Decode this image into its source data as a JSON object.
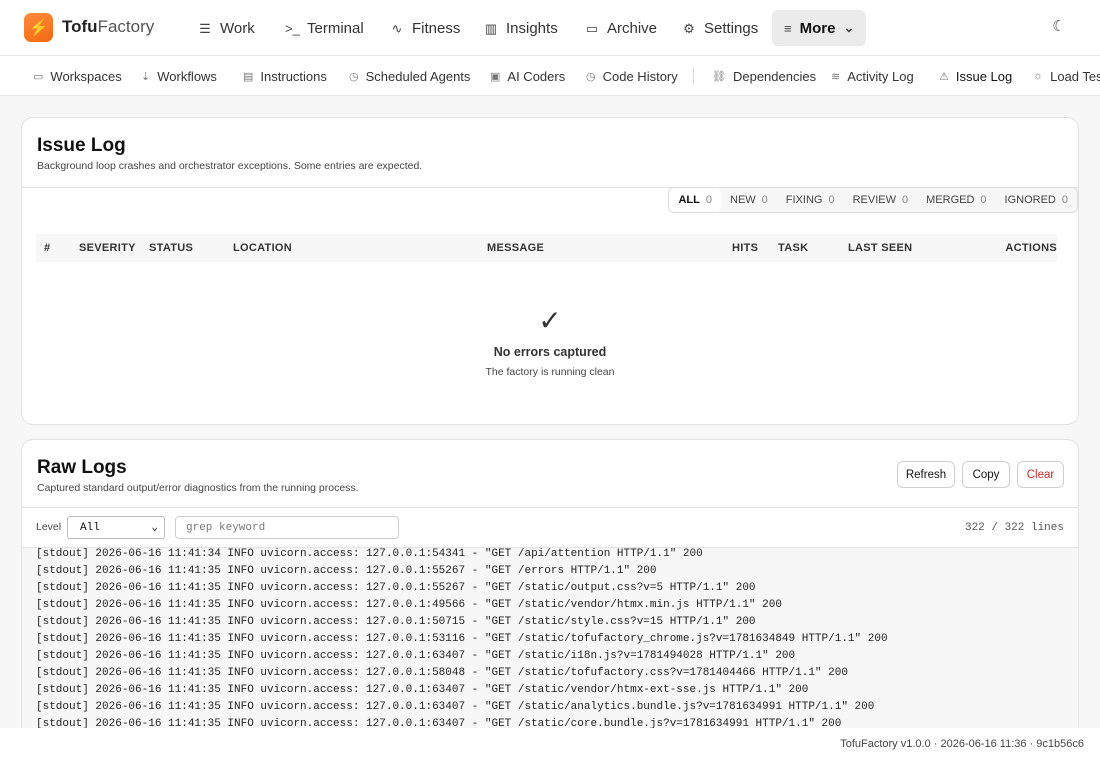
{
  "brand": {
    "name_bold": "Tofu",
    "name_rest": "Factory",
    "logo_glyph": "⚡",
    "accent": "#f36a12"
  },
  "topnav": [
    {
      "label": "Work",
      "icon": "list-icon",
      "glyph": "☰"
    },
    {
      "label": "Terminal",
      "icon": "terminal-icon",
      "glyph": ">_"
    },
    {
      "label": "Fitness",
      "icon": "pulse-icon",
      "glyph": "∿"
    },
    {
      "label": "Insights",
      "icon": "bar-chart-icon",
      "glyph": "▥"
    },
    {
      "label": "Archive",
      "icon": "archive-icon",
      "glyph": "▭"
    },
    {
      "label": "Settings",
      "icon": "gear-icon",
      "glyph": "⚙"
    },
    {
      "label": "More",
      "icon": "menu-icon",
      "glyph": "≡",
      "chevron": "⌄"
    }
  ],
  "theme_toggle_glyph": "☾",
  "subnav": [
    {
      "label": "Workspaces",
      "icon": "folder-icon",
      "glyph": "▭"
    },
    {
      "label": "Workflows",
      "icon": "workflow-icon",
      "glyph": "⇣"
    },
    {
      "label": "Instructions",
      "icon": "document-icon",
      "glyph": "▤"
    },
    {
      "label": "Scheduled Agents",
      "icon": "clock-icon",
      "glyph": "◷"
    },
    {
      "label": "AI Coders",
      "icon": "chip-icon",
      "glyph": "▣"
    },
    {
      "label": "Code History",
      "icon": "history-icon",
      "glyph": "◷"
    },
    {
      "label": "Dependencies",
      "icon": "link-icon",
      "glyph": "⛓"
    },
    {
      "label": "Activity Log",
      "icon": "wifi-icon",
      "glyph": "≋"
    },
    {
      "label": "Issue Log",
      "icon": "warning-icon",
      "glyph": "⚠",
      "active": true
    },
    {
      "label": "Load Test",
      "icon": "sun-icon",
      "glyph": "☼"
    }
  ],
  "issue_log": {
    "title": "Issue Log",
    "subtitle": "Background loop crashes and orchestrator exceptions. Some entries are expected.",
    "filters": [
      {
        "label": "ALL",
        "count": "0",
        "active": true
      },
      {
        "label": "NEW",
        "count": "0"
      },
      {
        "label": "FIXING",
        "count": "0"
      },
      {
        "label": "REVIEW",
        "count": "0"
      },
      {
        "label": "MERGED",
        "count": "0"
      },
      {
        "label": "IGNORED",
        "count": "0"
      }
    ],
    "columns": [
      "#",
      "SEVERITY",
      "STATUS",
      "LOCATION",
      "MESSAGE",
      "HITS",
      "TASK",
      "LAST SEEN",
      "ACTIONS"
    ],
    "empty_glyph": "✓",
    "empty_title": "No errors captured",
    "empty_subtitle": "The factory is running clean"
  },
  "raw_logs": {
    "title": "Raw Logs",
    "subtitle": "Captured standard output/error diagnostics from the running process.",
    "buttons": {
      "refresh": "Refresh",
      "copy": "Copy",
      "clear": "Clear"
    },
    "danger_color": "#c62828",
    "level_label": "Level",
    "level_value": "All",
    "grep_placeholder": "grep keyword",
    "line_count": "322 / 322 lines",
    "lines": [
      "[stdout] 2026-06-16 11:41:34 INFO uvicorn.access: 127.0.0.1:54341 - \"GET /api/attention HTTP/1.1\" 200",
      "[stdout] 2026-06-16 11:41:35 INFO uvicorn.access: 127.0.0.1:55267 - \"GET /errors HTTP/1.1\" 200",
      "[stdout] 2026-06-16 11:41:35 INFO uvicorn.access: 127.0.0.1:55267 - \"GET /static/output.css?v=5 HTTP/1.1\" 200",
      "[stdout] 2026-06-16 11:41:35 INFO uvicorn.access: 127.0.0.1:49566 - \"GET /static/vendor/htmx.min.js HTTP/1.1\" 200",
      "[stdout] 2026-06-16 11:41:35 INFO uvicorn.access: 127.0.0.1:50715 - \"GET /static/style.css?v=15 HTTP/1.1\" 200",
      "[stdout] 2026-06-16 11:41:35 INFO uvicorn.access: 127.0.0.1:53116 - \"GET /static/tofufactory_chrome.js?v=1781634849 HTTP/1.1\" 200",
      "[stdout] 2026-06-16 11:41:35 INFO uvicorn.access: 127.0.0.1:63407 - \"GET /static/i18n.js?v=1781494028 HTTP/1.1\" 200",
      "[stdout] 2026-06-16 11:41:35 INFO uvicorn.access: 127.0.0.1:58048 - \"GET /static/tofufactory.css?v=1781404466 HTTP/1.1\" 200",
      "[stdout] 2026-06-16 11:41:35 INFO uvicorn.access: 127.0.0.1:63407 - \"GET /static/vendor/htmx-ext-sse.js HTTP/1.1\" 200",
      "[stdout] 2026-06-16 11:41:35 INFO uvicorn.access: 127.0.0.1:63407 - \"GET /static/analytics.bundle.js?v=1781634991 HTTP/1.1\" 200",
      "[stdout] 2026-06-16 11:41:35 INFO uvicorn.access: 127.0.0.1:63407 - \"GET /static/core.bundle.js?v=1781634991 HTTP/1.1\" 200"
    ]
  },
  "footer": "TofuFactory v1.0.0 · 2026-06-16 11:36 · 9c1b56c6"
}
